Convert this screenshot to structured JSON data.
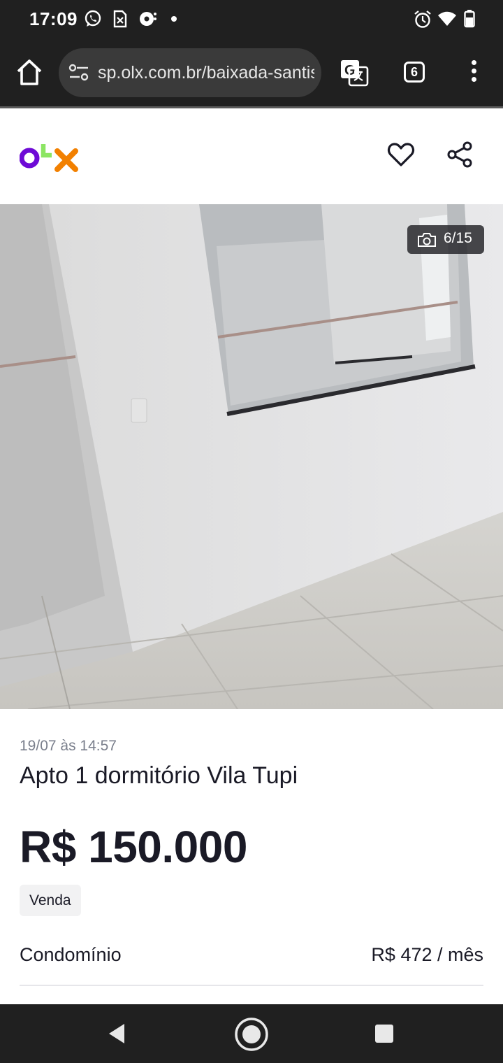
{
  "status_bar": {
    "time": "17:09",
    "left_icons": [
      "whatsapp-icon",
      "sim-missing-icon",
      "hotspot-icon",
      "notification-dot-icon"
    ],
    "right_icons": [
      "alarm-icon",
      "wifi-icon",
      "battery-icon"
    ]
  },
  "browser": {
    "url": "sp.olx.com.br/baixada-santista",
    "tab_count": "6",
    "colors": {
      "toolbar_bg": "#202020",
      "urlbar_bg": "#3a3a3a"
    }
  },
  "site": {
    "logo_letters": [
      "o",
      "L",
      "x"
    ],
    "logo_colors": [
      "#6e0ad6",
      "#8ce563",
      "#f28000"
    ]
  },
  "gallery": {
    "counter": "6/15",
    "photo_subject": "interior-room-image"
  },
  "listing": {
    "date": "19/07 às 14:57",
    "title": "Apto 1 dormitório Vila Tupi",
    "price": "R$ 150.000",
    "badge": "Venda",
    "details": [
      {
        "label": "Condomínio",
        "value": "R$ 472 / mês"
      }
    ]
  }
}
